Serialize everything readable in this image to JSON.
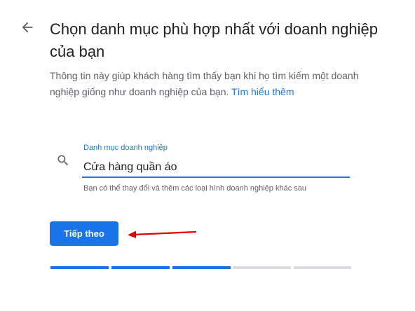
{
  "header": {
    "back_icon": "arrow-back-icon",
    "title": "Chọn danh mục phù hợp nhất với doanh nghiệp của bạn"
  },
  "description": {
    "text": "Thông tin này giúp khách hàng tìm thấy bạn khi họ tìm kiếm một doanh nghiệp giống như doanh nghiệp của bạn. ",
    "link": "Tìm hiểu thêm"
  },
  "category_field": {
    "icon": "search-icon",
    "label": "Danh mục doanh nghiệp",
    "value": "Cửa hàng quần áo",
    "helper": "Bạn có thể thay đổi và thêm các loại hình doanh nghiệp khác sau"
  },
  "actions": {
    "next_label": "Tiếp theo"
  },
  "annotation": {
    "icon": "red-arrow-icon",
    "color": "#e00000"
  },
  "progress": {
    "completed_steps": 3,
    "total_steps": 5,
    "active_color": "#1a73e8",
    "inactive_color": "#dadce0"
  }
}
